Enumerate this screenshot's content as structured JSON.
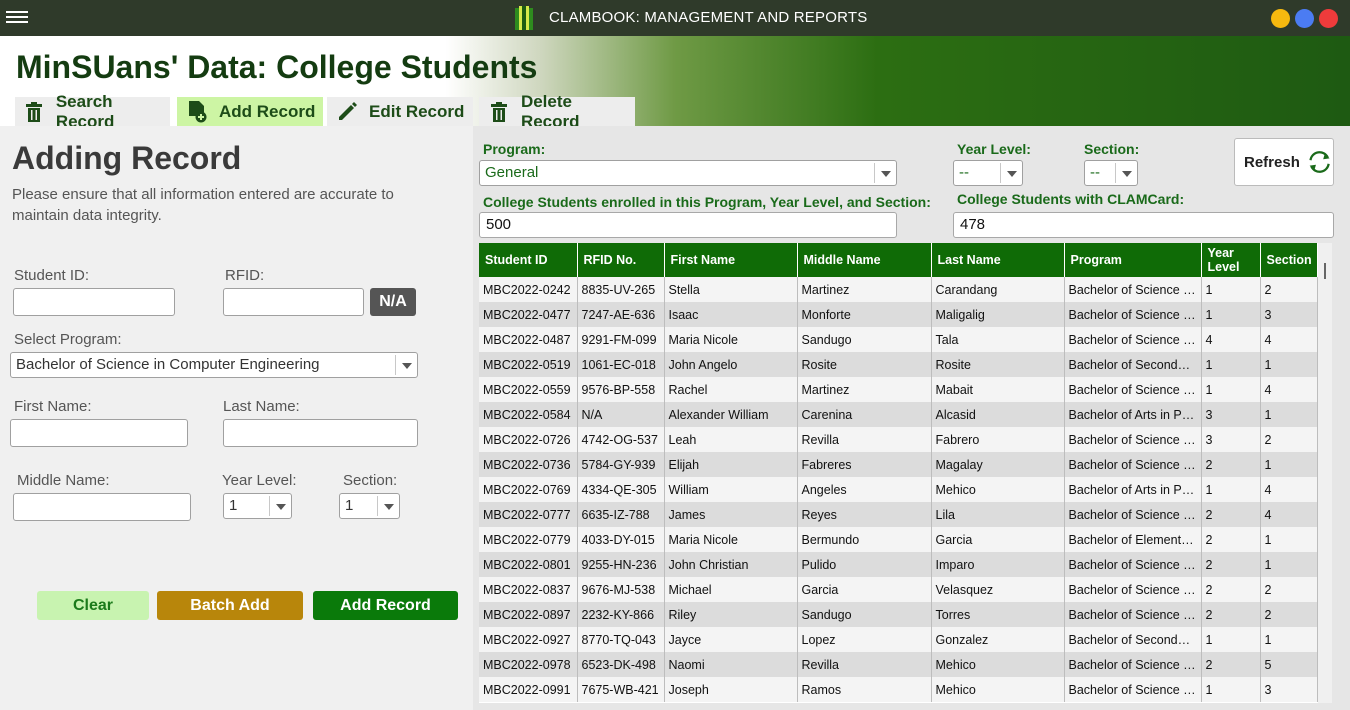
{
  "app_title": "CLAMBOOK: MANAGEMENT AND REPORTS",
  "window_controls": [
    "#f6b90f",
    "#4b7cf2",
    "#ef3b3b"
  ],
  "page_title": "MinSUans' Data: College Students",
  "tabs": [
    {
      "label": "Search Record",
      "icon": "trash-icon"
    },
    {
      "label": "Add Record",
      "icon": "add-file-icon"
    },
    {
      "label": "Edit Record",
      "icon": "pencil-icon"
    },
    {
      "label": "Delete Record",
      "icon": "trash-icon"
    }
  ],
  "form": {
    "heading": "Adding Record",
    "note": "Please ensure that all information entered are accurate to maintain data integrity.",
    "student_id_label": "Student ID:",
    "rfid_label": "RFID:",
    "na_label": "N/A",
    "program_label": "Select Program:",
    "program_value": "Bachelor of Science in Computer Engineering",
    "first_name_label": "First Name:",
    "last_name_label": "Last Name:",
    "middle_name_label": "Middle Name:",
    "year_level_label": "Year Level:",
    "year_level_value": "1",
    "section_label": "Section:",
    "section_value": "1",
    "clear_label": "Clear",
    "batch_add_label": "Batch Add",
    "add_record_label": "Add Record"
  },
  "filters": {
    "program_label": "Program:",
    "program_value": "General",
    "year_level_label": "Year Level:",
    "year_level_value": "--",
    "section_label": "Section:",
    "section_value": "--",
    "refresh_label": "Refresh",
    "enrolled_label": "College Students enrolled in this Program, Year Level, and Section:",
    "enrolled_value": "500",
    "clamcard_label": "College Students with CLAMCard:",
    "clamcard_value": "478"
  },
  "table": {
    "columns": [
      "Student ID",
      "RFID No.",
      "First Name",
      "Middle Name",
      "Last Name",
      "Program",
      "Year Level",
      "Section"
    ],
    "rows": [
      [
        "MBC2022-0242",
        "8835-UV-265",
        "Stella",
        "Martinez",
        "Carandang",
        "Bachelor of Science in...",
        "1",
        "2"
      ],
      [
        "MBC2022-0477",
        "7247-AE-636",
        "Isaac",
        "Monforte",
        "Maligalig",
        "Bachelor of Science in...",
        "1",
        "3"
      ],
      [
        "MBC2022-0487",
        "9291-FM-099",
        "Maria Nicole",
        "Sandugo",
        "Tala",
        "Bachelor of Science in...",
        "4",
        "4"
      ],
      [
        "MBC2022-0519",
        "1061-EC-018",
        "John Angelo",
        "Rosite",
        "Rosite",
        "Bachelor of Secondary...",
        "1",
        "1"
      ],
      [
        "MBC2022-0559",
        "9576-BP-558",
        "Rachel",
        "Martinez",
        "Mabait",
        "Bachelor of Science in...",
        "1",
        "4"
      ],
      [
        "MBC2022-0584",
        "N/A",
        "Alexander William",
        "Carenina",
        "Alcasid",
        "Bachelor of Arts in Pol...",
        "3",
        "1"
      ],
      [
        "MBC2022-0726",
        "4742-OG-537",
        "Leah",
        "Revilla",
        "Fabrero",
        "Bachelor of Science in...",
        "3",
        "2"
      ],
      [
        "MBC2022-0736",
        "5784-GY-939",
        "Elijah",
        "Fabreres",
        "Magalay",
        "Bachelor of Science in...",
        "2",
        "1"
      ],
      [
        "MBC2022-0769",
        "4334-QE-305",
        "William",
        "Angeles",
        "Mehico",
        "Bachelor of Arts in Pol...",
        "1",
        "4"
      ],
      [
        "MBC2022-0777",
        "6635-IZ-788",
        "James",
        "Reyes",
        "Lila",
        "Bachelor of Science in...",
        "2",
        "4"
      ],
      [
        "MBC2022-0779",
        "4033-DY-015",
        "Maria Nicole",
        "Bermundo",
        "Garcia",
        "Bachelor of Elementar...",
        "2",
        "1"
      ],
      [
        "MBC2022-0801",
        "9255-HN-236",
        "John Christian",
        "Pulido",
        "Imparo",
        "Bachelor of Science in...",
        "2",
        "1"
      ],
      [
        "MBC2022-0837",
        "9676-MJ-538",
        "Michael",
        "Garcia",
        "Velasquez",
        "Bachelor of Science in...",
        "2",
        "2"
      ],
      [
        "MBC2022-0897",
        "2232-KY-866",
        "Riley",
        "Sandugo",
        "Torres",
        "Bachelor of Science in...",
        "2",
        "2"
      ],
      [
        "MBC2022-0927",
        "8770-TQ-043",
        "Jayce",
        "Lopez",
        "Gonzalez",
        "Bachelor of Secondary...",
        "1",
        "1"
      ],
      [
        "MBC2022-0978",
        "6523-DK-498",
        "Naomi",
        "Revilla",
        "Mehico",
        "Bachelor of Science in...",
        "2",
        "5"
      ],
      [
        "MBC2022-0991",
        "7675-WB-421",
        "Joseph",
        "Ramos",
        "Mehico",
        "Bachelor of Science in...",
        "1",
        "3"
      ]
    ]
  }
}
